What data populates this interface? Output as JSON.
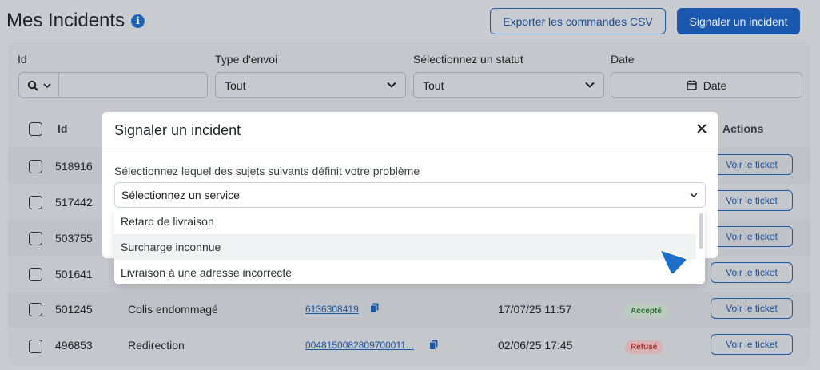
{
  "header": {
    "title": "Mes Incidents",
    "export_label": "Exporter les commandes CSV",
    "report_label": "Signaler un incident"
  },
  "filters": {
    "id_label": "Id",
    "id_value": "",
    "type_label": "Type d'envoi",
    "type_value": "Tout",
    "status_label": "Sélectionnez un statut",
    "status_value": "Tout",
    "date_label": "Date",
    "date_button": "Date"
  },
  "table": {
    "headers": {
      "id": "Id",
      "actions": "Actions"
    },
    "rows": [
      {
        "id": "518916",
        "subject": "",
        "tracking": "",
        "date": "",
        "status": "",
        "action": "Voir le ticket"
      },
      {
        "id": "517442",
        "subject": "",
        "tracking": "",
        "date": "",
        "status": "",
        "action": "Voir le ticket"
      },
      {
        "id": "503755",
        "subject": "",
        "tracking": "",
        "date": "",
        "status": "",
        "action": "Voir le ticket"
      },
      {
        "id": "501641",
        "subject": "",
        "tracking": "",
        "date": "",
        "status": "",
        "action": "Voir le ticket"
      },
      {
        "id": "501245",
        "subject": "Colis endommagé",
        "tracking": "6136308419",
        "date": "17/07/25 11:57",
        "status": "Accepté",
        "action": "Voir le ticket"
      },
      {
        "id": "496853",
        "subject": "Redirection",
        "tracking": "0048150082809700011...",
        "date": "02/06/25 17:45",
        "status": "Refusé",
        "action": "Voir le ticket"
      }
    ]
  },
  "modal": {
    "title": "Signaler un incident",
    "question": "Sélectionnez lequel des sujets suivants définit votre problème",
    "select_value": "Sélectionnez un service",
    "options": [
      "Retard de livraison",
      "Surcharge inconnue",
      "Livraison á une adresse incorrecte"
    ]
  },
  "colors": {
    "accent": "#1b58b0",
    "accepted": "#2f6d3b",
    "refused": "#a63131",
    "cursor": "#1d6fc9"
  }
}
